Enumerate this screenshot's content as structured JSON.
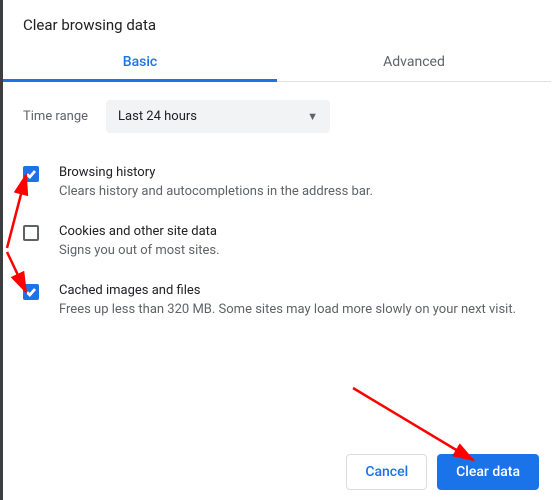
{
  "title": "Clear browsing data",
  "tabs": [
    {
      "label": "Basic",
      "active": true
    },
    {
      "label": "Advanced",
      "active": false
    }
  ],
  "time_range": {
    "label": "Time range",
    "selected": "Last 24 hours"
  },
  "options": [
    {
      "title": "Browsing history",
      "desc": "Clears history and autocompletions in the address bar.",
      "checked": true
    },
    {
      "title": "Cookies and other site data",
      "desc": "Signs you out of most sites.",
      "checked": false
    },
    {
      "title": "Cached images and files",
      "desc": "Frees up less than 320 MB. Some sites may load more slowly on your next visit.",
      "checked": true
    }
  ],
  "buttons": {
    "cancel": "Cancel",
    "clear": "Clear data"
  },
  "colors": {
    "accent": "#1a73e8",
    "text_primary": "#202124",
    "text_secondary": "#5f6368",
    "annotation": "#ff0000"
  }
}
